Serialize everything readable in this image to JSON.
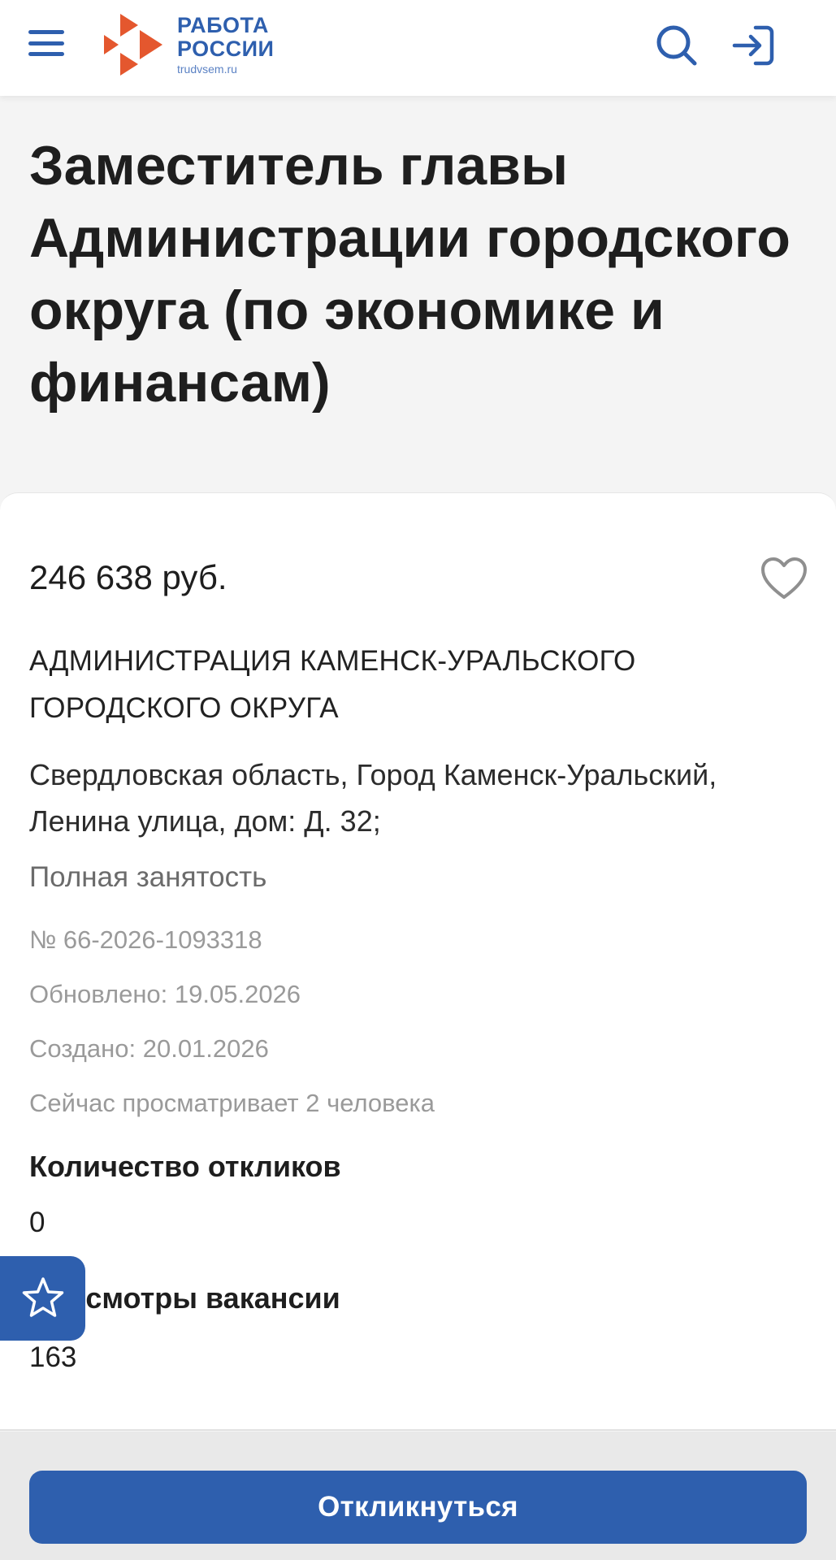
{
  "header": {
    "menu_icon": "hamburger-menu-icon",
    "logo": {
      "line1": "РАБОТА",
      "line2": "РОССИИ",
      "site": "trudvsem.ru"
    },
    "search_icon": "search-icon",
    "login_icon": "login-icon"
  },
  "vacancy": {
    "title": "Заместитель главы Администрации городского округа (по экономике и финансам)",
    "salary": "246 638 руб.",
    "company": "АДМИНИСТРАЦИЯ КАМЕНСК-УРАЛЬСКОГО ГОРОДСКОГО ОКРУГА",
    "address": "Свердловская область, Город Каменск-Уральский, Ленина улица, дом: Д. 32;",
    "employment": "Полная занятость",
    "number": "№ 66-2026-1093318",
    "updated": "Обновлено: 19.05.2026",
    "created": "Создано: 20.01.2026",
    "watching": "Сейчас просматривает 2 человека",
    "responses_label": "Количество откликов",
    "responses_value": "0",
    "views_label": "Просмотры вакансии",
    "views_value": "163"
  },
  "actions": {
    "apply_label": "Откликнуться",
    "favorite_icon": "heart-icon",
    "rate_icon": "star-icon"
  },
  "colors": {
    "brand_blue": "#2e5fae",
    "brand_orange": "#e4572e",
    "background": "#f4f4f4",
    "card": "#ffffff"
  }
}
